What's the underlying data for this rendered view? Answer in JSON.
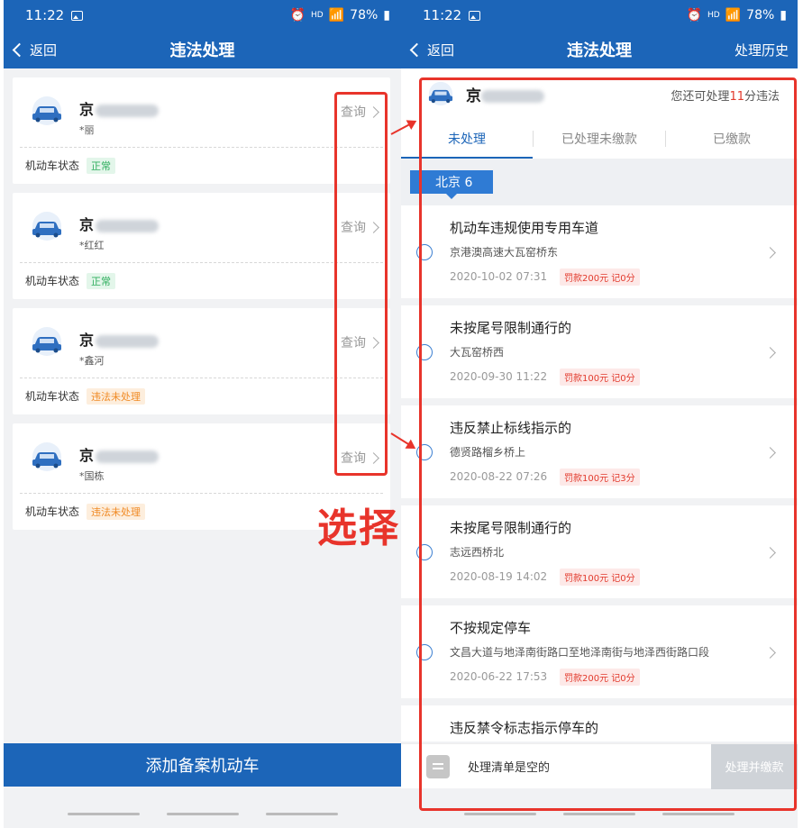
{
  "status": {
    "time": "11:22",
    "battery": "78%",
    "hd": "HD"
  },
  "left": {
    "nav": {
      "back": "返回",
      "title": "违法处理"
    },
    "cars": [
      {
        "plate_prefix": "京",
        "owner": "*丽",
        "query": "查询",
        "status_label": "机动车状态",
        "status": "正常",
        "status_type": "ok"
      },
      {
        "plate_prefix": "京",
        "owner": "*红红",
        "query": "查询",
        "status_label": "机动车状态",
        "status": "正常",
        "status_type": "ok"
      },
      {
        "plate_prefix": "京",
        "owner": "*鑫河",
        "query": "查询",
        "status_label": "机动车状态",
        "status": "违法未处理",
        "status_type": "warn"
      },
      {
        "plate_prefix": "京",
        "owner": "*国栋",
        "query": "查询",
        "status_label": "机动车状态",
        "status": "违法未处理",
        "status_type": "warn"
      }
    ],
    "add_button": "添加备案机动车"
  },
  "annotation": {
    "label": "选择",
    "color": "#e8342b"
  },
  "right": {
    "nav": {
      "back": "返回",
      "title": "违法处理",
      "history": "处理历史"
    },
    "car": {
      "plate_prefix": "京",
      "remain_prefix": "您还可处理",
      "remain_num": "11",
      "remain_suffix": "分违法"
    },
    "tabs": [
      "未处理",
      "已处理未缴款",
      "已缴款"
    ],
    "region": "北京 6",
    "violations": [
      {
        "title": "机动车违规使用专用车道",
        "place": "京港澳高速大瓦窑桥东",
        "date": "2020-10-02 07:31",
        "fine": "罚款200元 记0分"
      },
      {
        "title": "未按尾号限制通行的",
        "place": "大瓦窑桥西",
        "date": "2020-09-30 11:22",
        "fine": "罚款100元 记0分"
      },
      {
        "title": "违反禁止标线指示的",
        "place": "德贤路榴乡桥上",
        "date": "2020-08-22 07:26",
        "fine": "罚款100元 记3分"
      },
      {
        "title": "未按尾号限制通行的",
        "place": "志远西桥北",
        "date": "2020-08-19 14:02",
        "fine": "罚款100元 记0分"
      },
      {
        "title": "不按规定停车",
        "place": "文昌大道与地泽南街路口至地泽南街与地泽西街路口段",
        "date": "2020-06-22 17:53",
        "fine": "罚款200元 记0分"
      },
      {
        "title": "违反禁令标志指示停车的",
        "place": "",
        "date": "",
        "fine": ""
      }
    ],
    "cart_text": "处理清单是空的",
    "pay_button": "处理并缴款"
  },
  "colors": {
    "brand": "#1c65b8",
    "highlight": "#e8342b"
  }
}
